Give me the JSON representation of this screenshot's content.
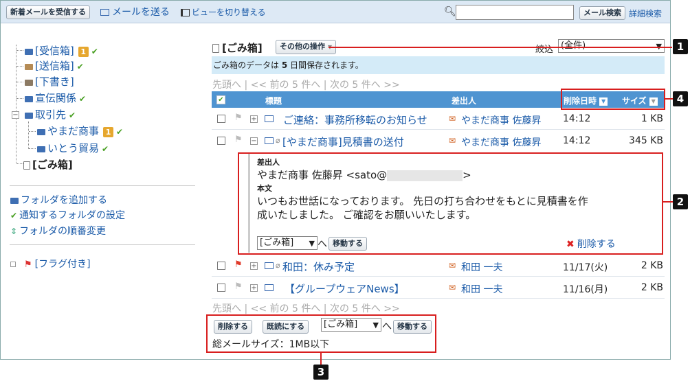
{
  "toolbar": {
    "receive": "新着メールを受信する",
    "send": "メールを送る",
    "view_toggle": "ビューを切り替える",
    "search_btn": "メール検索",
    "advanced": "詳細検索",
    "search_value": ""
  },
  "sidebar": {
    "folders": [
      {
        "label": "[受信箱]",
        "badge": "1"
      },
      {
        "label": "[送信箱]"
      },
      {
        "label": "[下書き]"
      },
      {
        "label": "宣伝関係"
      },
      {
        "label": "取引先"
      },
      {
        "label": "やまだ商事",
        "badge": "1"
      },
      {
        "label": "いとう貿易"
      },
      {
        "label": "[ごみ箱]"
      }
    ],
    "actions": {
      "add_folder": "フォルダを追加する",
      "notify": "通知するフォルダの設定",
      "reorder": "フォルダの順番変更"
    },
    "flagged": "[フラグ付き]"
  },
  "main": {
    "title": "[ごみ箱]",
    "other_ops": "その他の操作",
    "filter_label": "絞込",
    "filter_value": "(全件)",
    "notice_prefix": "ごみ箱のデータは ",
    "notice_days": "5",
    "notice_suffix": " 日間保存されます。",
    "pager": {
      "first": "先頭へ",
      "prev": "<< 前の 5 件へ",
      "next": "次の 5 件へ >>",
      "sep": "|"
    },
    "columns": {
      "subject": "標題",
      "sender": "差出人",
      "deleted_at": "削除日時",
      "size": "サイズ"
    },
    "rows": [
      {
        "subject": "ご連絡：事務所移転のお知らせ",
        "sender": "やまだ商事 佐藤昇",
        "time": "14:12",
        "size": "1 KB"
      },
      {
        "subject": "[やまだ商事]見積書の送付",
        "sender": "やまだ商事 佐藤昇",
        "time": "14:12",
        "size": "345 KB"
      },
      {
        "subject": "和田：休み予定",
        "sender": "和田 一夫",
        "time": "11/17(火)",
        "size": "2 KB"
      },
      {
        "subject": "【グループウェアNews】",
        "sender": "和田 一夫",
        "time": "11/16(月)",
        "size": "2 KB"
      }
    ],
    "preview": {
      "from_label": "差出人",
      "from_value_prefix": "やまだ商事 佐藤昇 <sato@",
      "from_value_suffix": ">",
      "body_label": "本文",
      "body_line1": "いつもお世話になっております。 先日の打ち合わせをもとに見積書を作",
      "body_line2": "成いたしました。 ご確認をお願いいたします。",
      "move_select": "[ごみ箱]",
      "move_suffix": "へ",
      "move_btn": "移動する",
      "delete": "削除する"
    },
    "bottom": {
      "delete_btn": "削除する",
      "read_btn": "既読にする",
      "move_select": "[ごみ箱]",
      "move_suffix": "へ",
      "move_btn": "移動する",
      "total": "総メールサイズ：1MB以下"
    }
  },
  "callouts": [
    "1",
    "2",
    "3",
    "4"
  ]
}
